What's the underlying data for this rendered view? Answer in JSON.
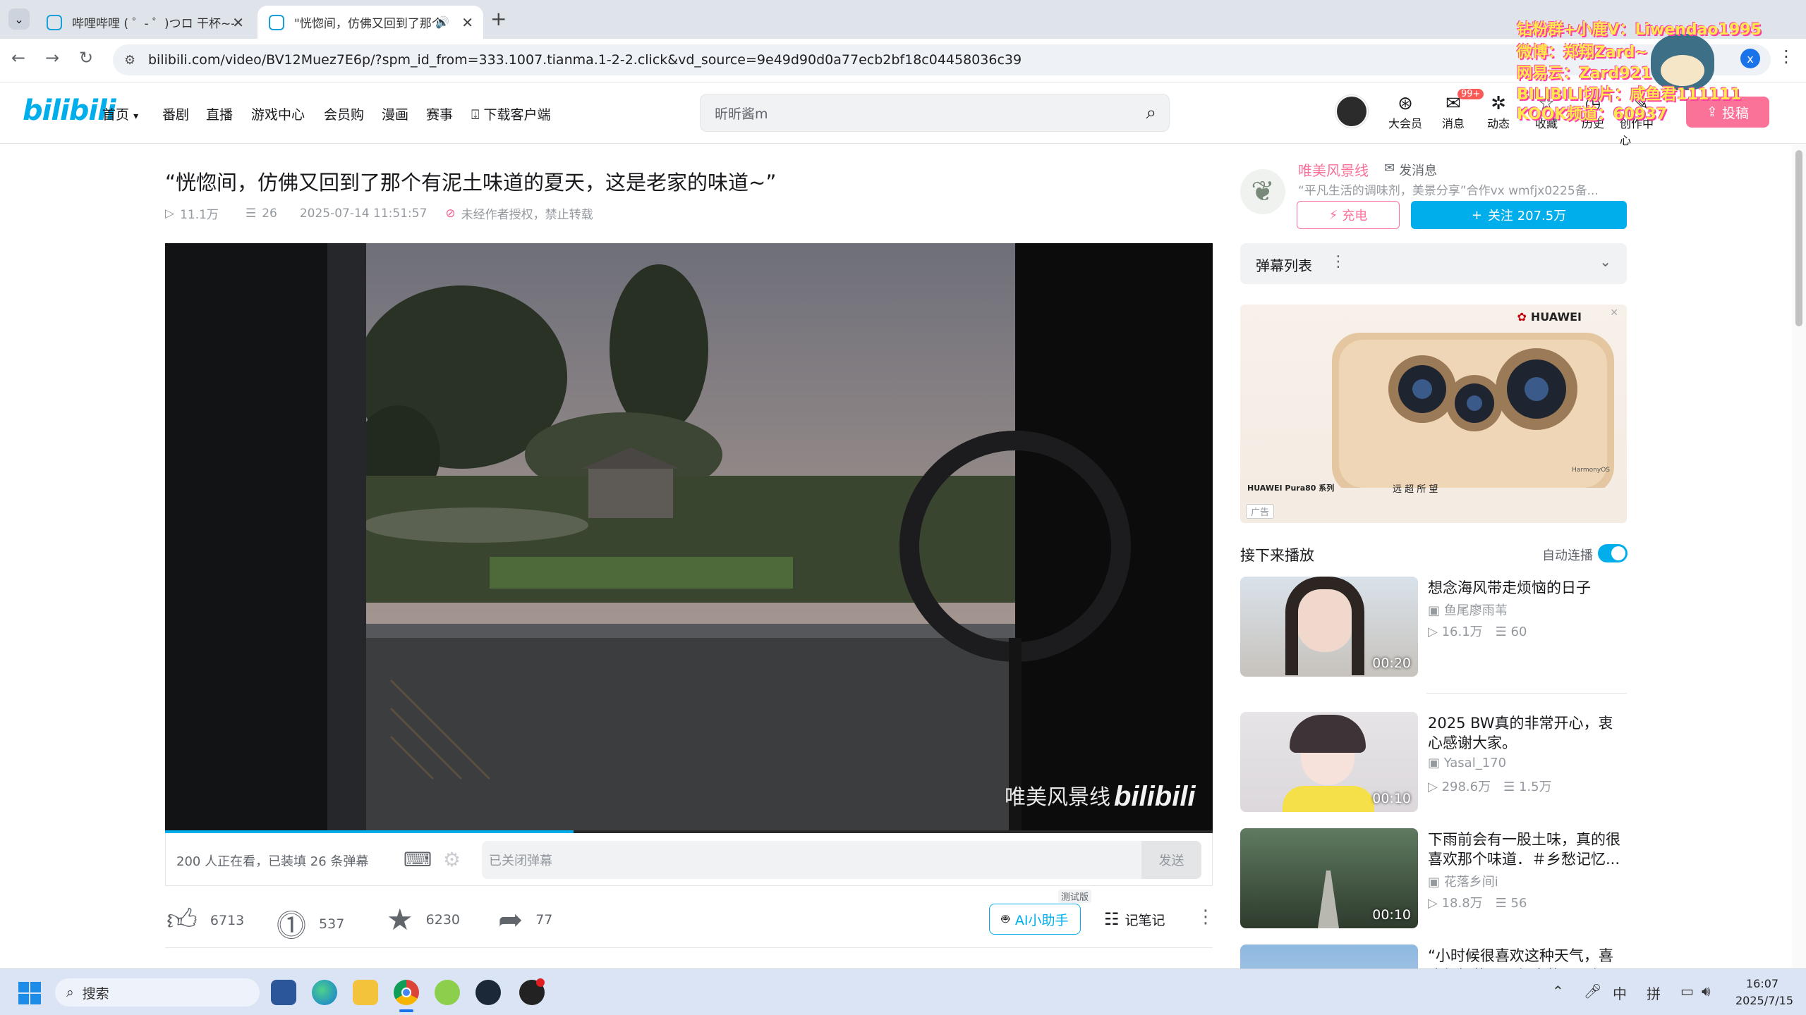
{
  "browser": {
    "tabs": [
      {
        "title": "哔哩哔哩 ( ゜- ゜)つロ 干杯~-bilibili"
      },
      {
        "title": "\"恍惚间，仿佛又回到了那个有泥土味道的夏天，这是老家的味道~\""
      }
    ],
    "url": "bilibili.com/video/BV12Muez7E6p/?spm_id_from=333.1007.tianma.1-2-2.click&vd_source=9e49d90d0a77ecb2bf18c04458036c39",
    "profile_initial": "x"
  },
  "site": {
    "logo": "bilibili",
    "nav": [
      "首页",
      "番剧",
      "直播",
      "游戏中心",
      "会员购",
      "漫画",
      "赛事",
      "下载客户端"
    ],
    "search_placeholder": "昕昕酱m",
    "header_icons": [
      {
        "icon": "vip-icon",
        "label": "大会员"
      },
      {
        "icon": "message-icon",
        "label": "消息",
        "badge": "99+"
      },
      {
        "icon": "dynamic-icon",
        "label": "动态"
      },
      {
        "icon": "favorite-icon",
        "label": "收藏"
      },
      {
        "icon": "history-icon",
        "label": "历史"
      },
      {
        "icon": "creator-icon",
        "label": "创作中心"
      }
    ],
    "upload_label": "投稿"
  },
  "overlay": {
    "lines": [
      "钻粉群+小鹿V：Liwendao1995",
      "微博：郑翔Zard~",
      "网易云：Zard921",
      "BILIBILI切片：咸鱼君111111",
      "KOOK频道：60937"
    ]
  },
  "video": {
    "title": "“恍惚间，仿佛又回到了那个有泥土味道的夏天，这是老家的味道~”",
    "views": "11.1万",
    "danmaku_count": "26",
    "date": "2025-07-14 11:51:57",
    "copyright": "未经作者授权，禁止转载",
    "watermark": "唯美风景线",
    "watermark_logo": "bilibili",
    "progress": 0.39,
    "watching": "200 人正在看，已装填 26 条弹幕",
    "danmaku_placeholder": "已关闭弹幕",
    "send_label": "发送",
    "likes": "6713",
    "coins": "537",
    "favorites": "6230",
    "shares": "77",
    "ai_badge": "测试版",
    "ai_label": "AI小助手",
    "note_label": "记笔记"
  },
  "uploader": {
    "name": "唯美风景线",
    "message_label": "发消息",
    "bio": "“平凡生活的调味剂，美景分享”合作vx wmfjx0225备...",
    "charge_label": "充电",
    "follow_label": "关注 207.5万"
  },
  "danmaku_list": {
    "label": "弹幕列表"
  },
  "ad": {
    "brand": "HUAWEI",
    "model": "HUAWEI Pura80 系列",
    "slogan": "远 超 所 望",
    "tag": "广告",
    "os": "HarmonyOS"
  },
  "recommend": {
    "header": "接下来播放",
    "autoplay_label": "自动连播",
    "autoplay_on": true,
    "items": [
      {
        "title": "想念海风带走烦恼的日子",
        "up": "鱼尾廖雨苇",
        "views": "16.1万",
        "danmaku": "60",
        "duration": "00:20"
      },
      {
        "title": "2025 BW真的非常开心，衷心感谢大家。",
        "up": "Yasal_170",
        "views": "298.6万",
        "danmaku": "1.5万",
        "duration": "00:10"
      },
      {
        "title": "下雨前会有一股土味，真的很喜欢那个味道．＃乡愁记忆...",
        "up": "花落乡间i",
        "views": "18.8万",
        "danmaku": "56",
        "duration": "00:10"
      },
      {
        "title": "“小时候很喜欢这种天气，喜欢很轻的风，很大的云，很"
      }
    ]
  },
  "taskbar": {
    "search_placeholder": "搜索",
    "ime_lang": "中",
    "ime_mode": "拼",
    "time": "16:07",
    "date": "2025/7/15"
  }
}
